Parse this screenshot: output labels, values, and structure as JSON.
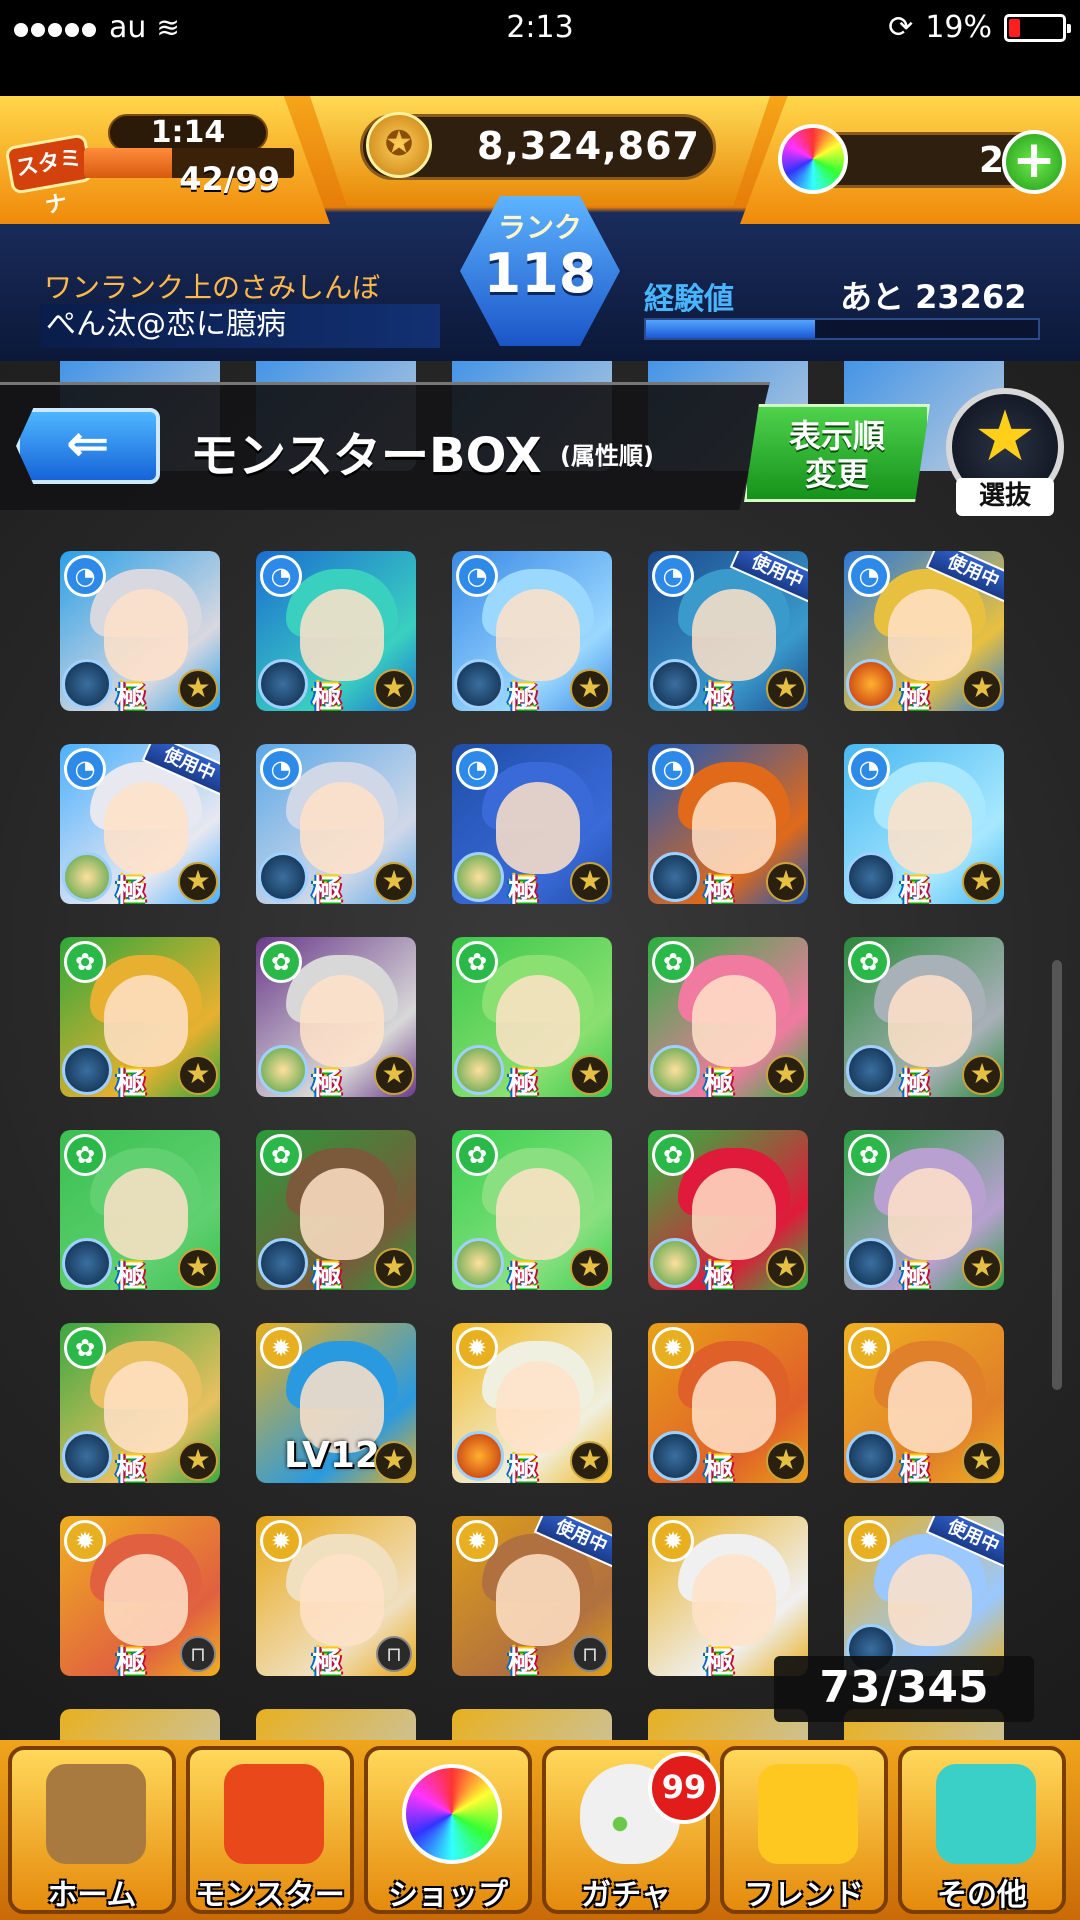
{
  "status_bar": {
    "carrier": "au",
    "time": "2:13",
    "battery": "19%",
    "battery_level": 0.19
  },
  "header": {
    "stamina_label": "スタミナ",
    "stamina_timer": "1:14",
    "stamina": "42/99",
    "stamina_fraction": 0.42,
    "gold": "8,324,867",
    "orbs": "2",
    "rank_label": "ランク",
    "rank": "118",
    "player_title": "ワンランク上のさみしんぼ",
    "player_name": "ぺん汰@恋に臆病",
    "exp_label": "経験値",
    "exp_remaining": "あと 23262",
    "exp_fraction": 0.43
  },
  "box": {
    "title": "モンスターBOX",
    "sort_label": "(属性順)",
    "sort_change_line1": "表示順",
    "sort_change_line2": "変更",
    "select_label": "選抜",
    "count": "73/345",
    "kyoku_label": "極",
    "in_use_label": "使用中",
    "rows": [
      [
        {
          "element": "water",
          "ability": "water",
          "badge": "star",
          "kyoku": true,
          "in_use": false,
          "level": "",
          "palette": [
            "#2aa0e8",
            "#d8d8e0"
          ]
        },
        {
          "element": "water",
          "ability": "water",
          "badge": "star",
          "kyoku": true,
          "in_use": false,
          "level": "",
          "palette": [
            "#1b6ed0",
            "#3ad0c0"
          ]
        },
        {
          "element": "water",
          "ability": "water",
          "badge": "star",
          "kyoku": true,
          "in_use": false,
          "level": "",
          "palette": [
            "#3a8ae6",
            "#9ad8ff"
          ]
        },
        {
          "element": "water",
          "ability": "water",
          "badge": "star",
          "kyoku": true,
          "in_use": true,
          "level": "",
          "palette": [
            "#1b4a8e",
            "#3a9acb"
          ]
        },
        {
          "element": "water",
          "ability": "fire",
          "badge": "star",
          "kyoku": true,
          "in_use": true,
          "level": "",
          "palette": [
            "#2a7ad8",
            "#e8c040"
          ]
        }
      ],
      [
        {
          "element": "water",
          "ability": "wood",
          "badge": "star",
          "kyoku": true,
          "in_use": true,
          "level": "",
          "palette": [
            "#4ab0ff",
            "#e8e8f0"
          ]
        },
        {
          "element": "water",
          "ability": "water",
          "badge": "star",
          "kyoku": true,
          "in_use": false,
          "level": "",
          "palette": [
            "#5aa8e8",
            "#d0d8e8"
          ]
        },
        {
          "element": "water",
          "ability": "wood",
          "badge": "star",
          "kyoku": true,
          "in_use": false,
          "level": "",
          "palette": [
            "#1e4ea8",
            "#3a6ad8"
          ]
        },
        {
          "element": "water",
          "ability": "water",
          "badge": "star",
          "kyoku": true,
          "in_use": false,
          "level": "",
          "palette": [
            "#1b58b8",
            "#e06a1a"
          ]
        },
        {
          "element": "water",
          "ability": "water",
          "badge": "star",
          "kyoku": true,
          "in_use": false,
          "level": "",
          "palette": [
            "#48b8f0",
            "#a8e8ff"
          ]
        }
      ],
      [
        {
          "element": "wood",
          "ability": "water",
          "badge": "star",
          "kyoku": true,
          "in_use": false,
          "level": "",
          "palette": [
            "#2ea83a",
            "#e8b030"
          ]
        },
        {
          "element": "wood",
          "ability": "wood",
          "badge": "star",
          "kyoku": true,
          "in_use": false,
          "level": "",
          "palette": [
            "#6a3a8a",
            "#d8d8d8"
          ]
        },
        {
          "element": "wood",
          "ability": "wood",
          "badge": "star",
          "kyoku": true,
          "in_use": false,
          "level": "",
          "palette": [
            "#3ac84a",
            "#8ae070"
          ]
        },
        {
          "element": "wood",
          "ability": "wood",
          "badge": "star",
          "kyoku": true,
          "in_use": false,
          "level": "",
          "palette": [
            "#2ab040",
            "#f07aa0"
          ]
        },
        {
          "element": "wood",
          "ability": "water",
          "badge": "star",
          "kyoku": true,
          "in_use": false,
          "level": "",
          "palette": [
            "#2a8a3a",
            "#a8b0b8"
          ]
        }
      ],
      [
        {
          "element": "wood",
          "ability": "water",
          "badge": "star",
          "kyoku": true,
          "in_use": false,
          "level": "",
          "palette": [
            "#3ac050",
            "#60d070"
          ]
        },
        {
          "element": "wood",
          "ability": "water",
          "badge": "star",
          "kyoku": true,
          "in_use": false,
          "level": "",
          "palette": [
            "#2a9a3a",
            "#7a5a3a"
          ]
        },
        {
          "element": "wood",
          "ability": "wood",
          "badge": "star",
          "kyoku": true,
          "in_use": false,
          "level": "",
          "palette": [
            "#3ad050",
            "#8ae080"
          ]
        },
        {
          "element": "wood",
          "ability": "wood",
          "badge": "star",
          "kyoku": true,
          "in_use": false,
          "level": "",
          "palette": [
            "#2ab840",
            "#e01a3a"
          ]
        },
        {
          "element": "wood",
          "ability": "water",
          "badge": "star",
          "kyoku": true,
          "in_use": false,
          "level": "",
          "palette": [
            "#2aa040",
            "#b8a0d0"
          ]
        }
      ],
      [
        {
          "element": "wood",
          "ability": "water",
          "badge": "star",
          "kyoku": true,
          "in_use": false,
          "level": "",
          "palette": [
            "#3aa840",
            "#e8c060"
          ]
        },
        {
          "element": "light",
          "ability": "",
          "badge": "star",
          "kyoku": false,
          "in_use": false,
          "level": "LV12",
          "palette": [
            "#e8b020",
            "#2a9ae0"
          ]
        },
        {
          "element": "light",
          "ability": "fire",
          "badge": "star",
          "kyoku": true,
          "in_use": false,
          "level": "",
          "palette": [
            "#f0b820",
            "#f0f0e0"
          ]
        },
        {
          "element": "light",
          "ability": "water",
          "badge": "star",
          "kyoku": true,
          "in_use": false,
          "level": "",
          "palette": [
            "#e8a018",
            "#e0602a"
          ]
        },
        {
          "element": "light",
          "ability": "water",
          "badge": "star",
          "kyoku": true,
          "in_use": false,
          "level": "",
          "palette": [
            "#f0b020",
            "#e0802a"
          ]
        }
      ],
      [
        {
          "element": "light",
          "ability": "",
          "badge": "lock",
          "kyoku": true,
          "in_use": false,
          "level": "",
          "palette": [
            "#f0b020",
            "#e06040"
          ]
        },
        {
          "element": "light",
          "ability": "",
          "badge": "lock",
          "kyoku": true,
          "in_use": false,
          "level": "",
          "palette": [
            "#e8a818",
            "#f0e0c0"
          ]
        },
        {
          "element": "light",
          "ability": "",
          "badge": "lock",
          "kyoku": true,
          "in_use": true,
          "level": "",
          "palette": [
            "#e0a018",
            "#b07040"
          ]
        },
        {
          "element": "light",
          "ability": "",
          "badge": "",
          "kyoku": true,
          "in_use": false,
          "level": "",
          "palette": [
            "#e8b020",
            "#f0f0f0"
          ]
        },
        {
          "element": "light",
          "ability": "water",
          "badge": "",
          "kyoku": false,
          "in_use": true,
          "level": "",
          "palette": [
            "#e8b020",
            "#9ac8ff"
          ]
        }
      ]
    ]
  },
  "nav": [
    {
      "label": "ホーム",
      "icon": "home-gate-icon",
      "color": "#a87a40"
    },
    {
      "label": "モンスター",
      "icon": "monster-icon",
      "color": "#e8481a"
    },
    {
      "label": "ショップ",
      "icon": "rainbow-orb-icon",
      "color": "#7a60e0"
    },
    {
      "label": "ガチャ",
      "icon": "egg-icon",
      "color": "#f0f0f0"
    },
    {
      "label": "フレンド",
      "icon": "friends-icon",
      "color": "#ffc820"
    },
    {
      "label": "その他",
      "icon": "more-icon",
      "color": "#3ad0c8"
    }
  ],
  "gacha_badge": "99",
  "colors": {
    "water": "#2e8ae8",
    "wood": "#2ab848",
    "light": "#e8b020",
    "fire": "#e8481a"
  }
}
